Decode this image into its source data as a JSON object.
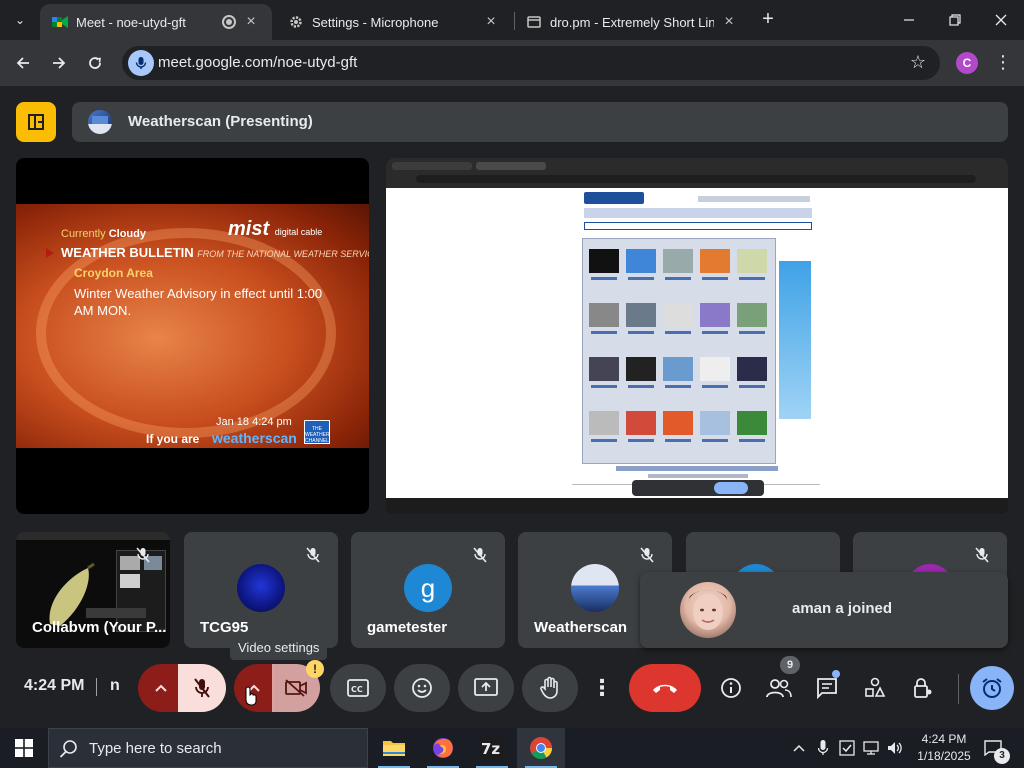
{
  "browser": {
    "tabs": [
      {
        "label": "Meet - noe-utyd-gft",
        "active": true
      },
      {
        "label": "Settings - Microphone",
        "active": false
      },
      {
        "label": "dro.pm - Extremely Short Links",
        "active": false
      }
    ],
    "url": "meet.google.com/noe-utyd-gft",
    "profile_initial": "C"
  },
  "meet": {
    "presenting_label": "Weatherscan (Presenting)",
    "weather": {
      "current_prefix": "Currently",
      "current_condition": "Cloudy",
      "bulletin_title": "WEATHER BULLETIN",
      "bulletin_source": "FROM THE NATIONAL WEATHER SERVICE",
      "area": "Croydon Area",
      "advisory": "Winter Weather Advisory in effect until 1:00 AM MON.",
      "provider": "mist",
      "provider_sub": "digital cable",
      "datetime": "Jan 18   4:24 pm",
      "tagline_prefix": "If you are",
      "tagline_brand": "weatherscan",
      "channel_badge": "THE WEATHER CHANNEL"
    },
    "participants": [
      {
        "name": "Collabvm (Your P...",
        "muted": true
      },
      {
        "name": "TCG95",
        "muted": true
      },
      {
        "name": "gametester",
        "initial": "g",
        "muted": true
      },
      {
        "name": "Weatherscan",
        "muted": true
      },
      {
        "name": "",
        "muted": false
      },
      {
        "name": "",
        "muted": true
      }
    ],
    "toast": {
      "text": "aman a joined"
    },
    "tooltip": "Video settings",
    "clock": "4:24 PM",
    "meeting_code_fragment": "n",
    "badges": {
      "camera_warning": "!",
      "people_count": "9"
    },
    "colors": {
      "accent": "#8ab4f8",
      "leave": "#dc362e",
      "mic_off_bg": "#f9dedc",
      "layout": "#fbbc04"
    }
  },
  "taskbar": {
    "search_placeholder": "Type here to search",
    "time": "4:24 PM",
    "date": "1/18/2025",
    "notification_count": "3",
    "apps": [
      "file-explorer-icon",
      "firefox-icon",
      "7zip-icon",
      "chrome-icon"
    ]
  }
}
